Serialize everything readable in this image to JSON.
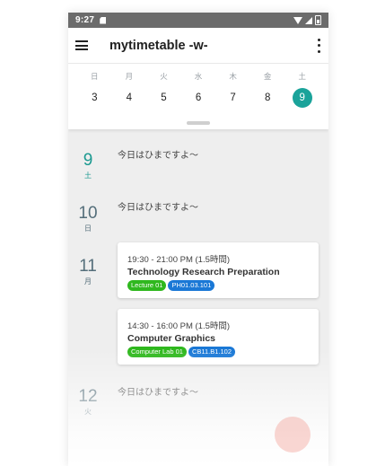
{
  "status_bar": {
    "time": "9:27"
  },
  "app_bar": {
    "title": "mytimetable -w-"
  },
  "week": {
    "days": [
      {
        "dow": "日",
        "date": "3"
      },
      {
        "dow": "月",
        "date": "4"
      },
      {
        "dow": "火",
        "date": "5"
      },
      {
        "dow": "水",
        "date": "6"
      },
      {
        "dow": "木",
        "date": "7"
      },
      {
        "dow": "金",
        "date": "8"
      },
      {
        "dow": "土",
        "date": "9",
        "selected": true
      }
    ]
  },
  "timeline": {
    "day9": {
      "num": "9",
      "dow": "土",
      "message": "今日はひまですよ～"
    },
    "day10": {
      "num": "10",
      "dow": "日",
      "message": "今日はひまですよ～"
    },
    "day11": {
      "num": "11",
      "dow": "月",
      "events": [
        {
          "time": "19:30 - 21:00 PM (1.5時間)",
          "title": "Technology Research Preparation",
          "tags": [
            "Lecture 01",
            "PH01.03.101"
          ]
        },
        {
          "time": "14:30 - 16:00 PM (1.5時間)",
          "title": "Computer Graphics",
          "tags": [
            "Computer Lab 01",
            "CB11.B1.102"
          ]
        }
      ]
    },
    "day12": {
      "num": "12",
      "dow": "火",
      "message": "今日はひまですよ～"
    }
  },
  "colors": {
    "accent": "#1aa39a",
    "tag_green": "#2fb81e",
    "tag_blue": "#1a78d6",
    "fab": "#f08b80"
  }
}
